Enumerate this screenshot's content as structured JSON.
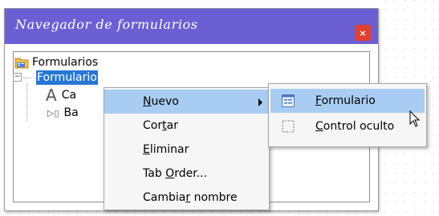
{
  "window": {
    "title": "Navegador de formularios",
    "close_label": "×"
  },
  "tree": {
    "root_label": "Formularios",
    "form_label": "Formulario",
    "expander_symbol": "−",
    "child1_icon_glyph": "A",
    "child1_label": "Ca",
    "child2_icon_glyph": "▷▯",
    "child2_label": "Ba"
  },
  "context_menu": {
    "items": [
      {
        "pre": "",
        "key": "N",
        "post": "uevo",
        "has_submenu": true,
        "highlighted": true
      },
      {
        "pre": "Cor",
        "key": "t",
        "post": "ar",
        "has_submenu": false
      },
      {
        "pre": "",
        "key": "E",
        "post": "liminar",
        "has_submenu": false
      },
      {
        "pre": "Tab ",
        "key": "O",
        "post": "rder...",
        "has_submenu": false
      },
      {
        "pre": "Cambia",
        "key": "r",
        "post": " nombre",
        "has_submenu": false
      }
    ]
  },
  "submenu": {
    "items": [
      {
        "pre": "",
        "key": "F",
        "post": "ormulario",
        "icon": "form-icon",
        "highlighted": true
      },
      {
        "pre": "",
        "key": "C",
        "post": "ontrol oculto",
        "icon": "hidden-control-icon",
        "highlighted": false
      }
    ]
  },
  "colors": {
    "titlebar": "#6b5fd3",
    "close_button": "#e0402e",
    "selection": "#2777d4",
    "menu_highlight": "#a9cdf2"
  }
}
